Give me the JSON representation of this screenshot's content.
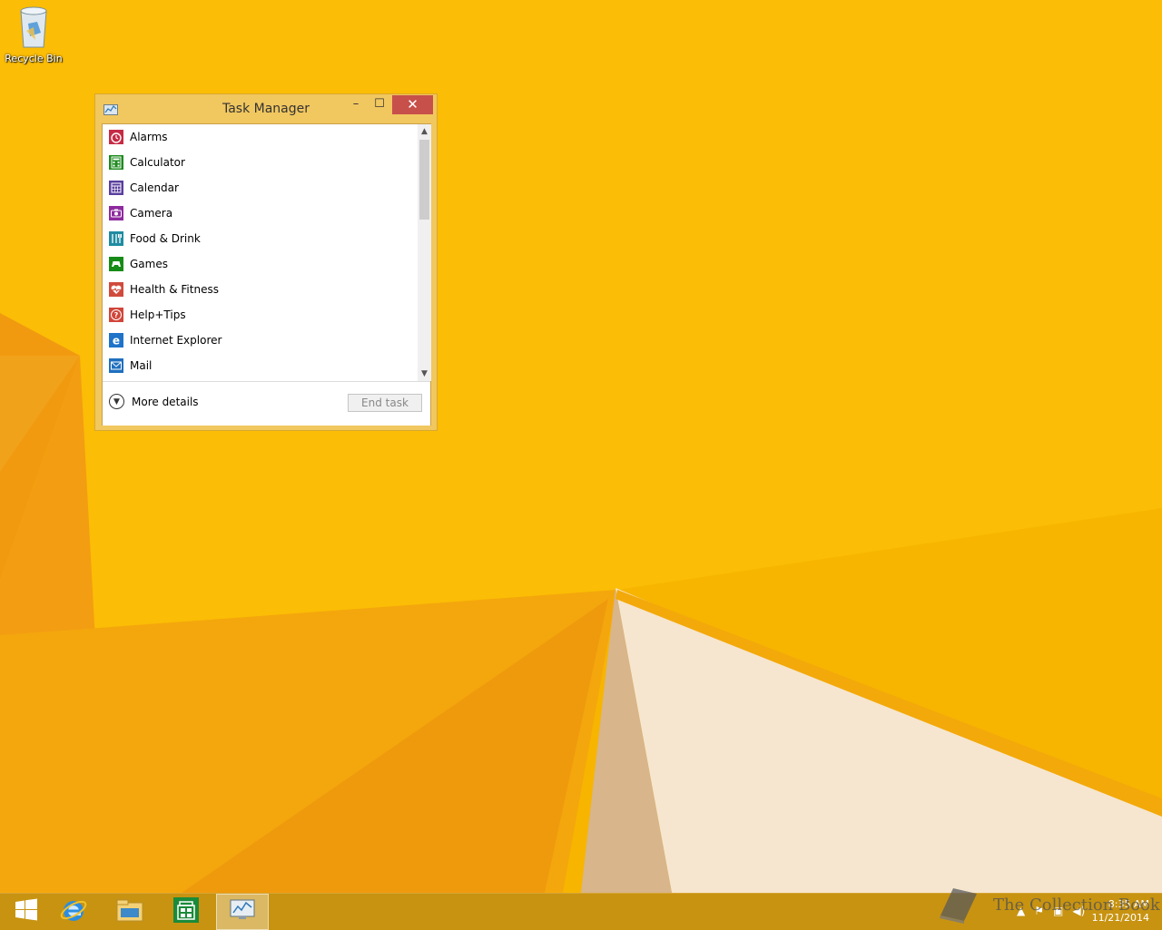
{
  "desktop": {
    "recycle_bin_label": "Recycle Bin"
  },
  "window": {
    "title": "Task Manager",
    "controls": {
      "minimize": "–",
      "maximize": "☐",
      "close": "✕"
    },
    "apps": [
      {
        "name": "Alarms",
        "icon": "alarm-icon",
        "color": "#c62b45"
      },
      {
        "name": "Calculator",
        "icon": "calculator-icon",
        "color": "#1e8a1e"
      },
      {
        "name": "Calendar",
        "icon": "calendar-icon",
        "color": "#5a3e9e"
      },
      {
        "name": "Camera",
        "icon": "camera-icon",
        "color": "#8e2a9e"
      },
      {
        "name": "Food & Drink",
        "icon": "food-drink-icon",
        "color": "#1f8ca0"
      },
      {
        "name": "Games",
        "icon": "games-icon",
        "color": "#178b17"
      },
      {
        "name": "Health & Fitness",
        "icon": "health-icon",
        "color": "#d04b3c"
      },
      {
        "name": "Help+Tips",
        "icon": "help-icon",
        "color": "#d0463a"
      },
      {
        "name": "Internet Explorer",
        "icon": "internet-explorer-icon",
        "color": "#1f73c8"
      },
      {
        "name": "Mail",
        "icon": "mail-icon",
        "color": "#1f6fbf"
      }
    ],
    "footer": {
      "more_details": "More details",
      "end_task": "End task"
    }
  },
  "taskbar": {
    "clock_time": "8:35 AM",
    "clock_date": "11/21/2014",
    "pinned": [
      "start-icon",
      "internet-explorer-icon",
      "file-explorer-icon",
      "store-icon",
      "task-manager-icon"
    ]
  },
  "watermark": "The Collection Book"
}
